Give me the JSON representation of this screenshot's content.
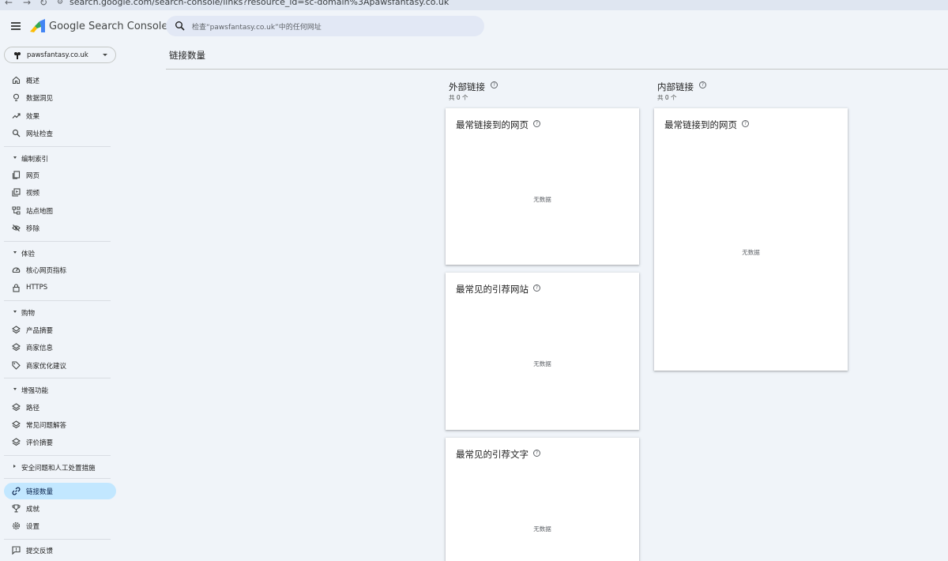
{
  "browser": {
    "back_glyph": "←",
    "forward_glyph": "→",
    "reload_glyph": "↻",
    "url": "search.google.com/search-console/links?resource_id=sc-domain%3Apawsfantasy.co.uk"
  },
  "app": {
    "title": "Google Search Console",
    "logo_colors": [
      "#fbbc04",
      "#34a853",
      "#4285f4"
    ]
  },
  "search": {
    "placeholder": "检查“pawsfantasy.co.uk”中的任何网址"
  },
  "property": {
    "name": "pawsfantasy.co.uk"
  },
  "sidebar": {
    "top_items": [
      {
        "label": "概述",
        "icon": "home-icon"
      },
      {
        "label": "数据洞见",
        "icon": "lightbulb-icon"
      },
      {
        "label": "效果",
        "icon": "trending-up-icon"
      },
      {
        "label": "网址检查",
        "icon": "search-icon"
      }
    ],
    "indexing": {
      "header": "编制索引",
      "items": [
        {
          "label": "网页",
          "icon": "pages-icon"
        },
        {
          "label": "视频",
          "icon": "video-icon"
        },
        {
          "label": "站点地图",
          "icon": "sitemap-icon"
        },
        {
          "label": "移除",
          "icon": "eye-off-icon"
        }
      ]
    },
    "experience": {
      "header": "体验",
      "items": [
        {
          "label": "核心网页指标",
          "icon": "speed-icon"
        },
        {
          "label": "HTTPS",
          "icon": "lock-icon"
        }
      ]
    },
    "shopping": {
      "header": "购物",
      "items": [
        {
          "label": "产品摘要",
          "icon": "layers-icon"
        },
        {
          "label": "商家信息",
          "icon": "layers-icon"
        },
        {
          "label": "商家优化建议",
          "icon": "tag-icon"
        }
      ]
    },
    "enhancements": {
      "header": "增强功能",
      "items": [
        {
          "label": "路径",
          "icon": "layers-icon"
        },
        {
          "label": "常见问题解答",
          "icon": "layers-icon"
        },
        {
          "label": "评价摘要",
          "icon": "layers-icon"
        }
      ]
    },
    "security": {
      "header": "安全问题和人工处置措施"
    },
    "bottom_items": [
      {
        "label": "链接数量",
        "icon": "link-icon",
        "active": true
      },
      {
        "label": "成就",
        "icon": "trophy-icon"
      },
      {
        "label": "设置",
        "icon": "settings-icon"
      }
    ],
    "feedback": {
      "label": "提交反馈",
      "icon": "feedback-icon"
    }
  },
  "page": {
    "title": "链接数量"
  },
  "external": {
    "title": "外部链接",
    "total": "共 0 个",
    "cards": {
      "top_linked_pages": {
        "title": "最常链接到的网页",
        "empty": "无数据"
      },
      "top_linking_sites": {
        "title": "最常见的引荐网站",
        "empty": "无数据"
      },
      "top_linking_text": {
        "title": "最常见的引荐文字",
        "empty": "无数据"
      }
    }
  },
  "internal": {
    "title": "内部链接",
    "total": "共 0 个",
    "cards": {
      "top_linked_pages": {
        "title": "最常链接到的网页",
        "empty": "无数据"
      }
    }
  },
  "colors": {
    "page_bg": "#f0f4f9",
    "active_nav_bg": "#c2e7ff",
    "search_bg": "#e2e8f5",
    "card_bg": "#ffffff"
  }
}
